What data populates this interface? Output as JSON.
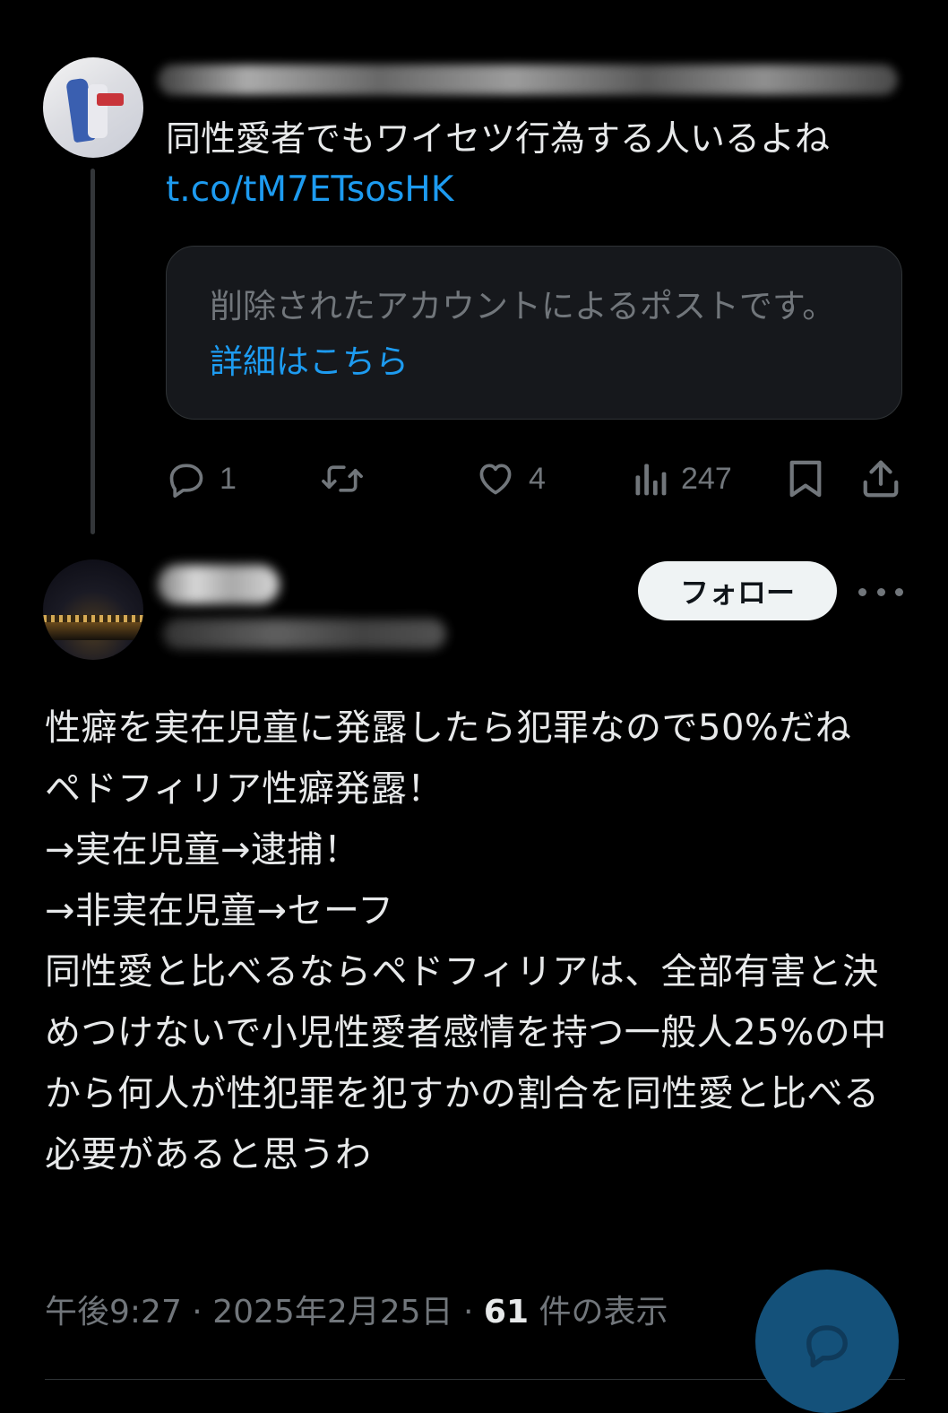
{
  "parent_post": {
    "text": "同性愛者でもワイセツ行為する人いるよね",
    "link": "t.co/tM7ETsosHK",
    "quote": {
      "message": "削除されたアカウントによるポストです。",
      "link_label": "詳細はこちら"
    },
    "actions": {
      "replies": "1",
      "reposts": "",
      "likes": "4",
      "views": "247"
    }
  },
  "main_post": {
    "follow_label": "フォロー",
    "text": "性癖を実在児童に発露したら犯罪なので50%だね\nペドフィリア性癖発露！\n→実在児童→逮捕！\n→非実在児童→セーフ\n同性愛と比べるならペドフィリアは、全部有害と決めつけないで小児性愛者感情を持つ一般人25%の中から何人が性犯罪を犯すかの割合を同性愛と比べる必要があると思うわ",
    "time": "午後9:27",
    "date": "2025年2月25日",
    "views_count": "61",
    "views_label": "件の表示",
    "separator": "·"
  },
  "icons": {
    "reply": "reply-icon",
    "repost": "repost-icon",
    "like": "heart-icon",
    "views": "analytics-icon",
    "bookmark": "bookmark-icon",
    "share": "share-icon",
    "more": "more-icon",
    "fab": "compose-reply-icon"
  },
  "colors": {
    "background": "#000000",
    "text": "#e7e9ea",
    "muted": "#71767b",
    "link": "#1d9bf0",
    "card": "#16181c",
    "fab": "#14517a"
  }
}
